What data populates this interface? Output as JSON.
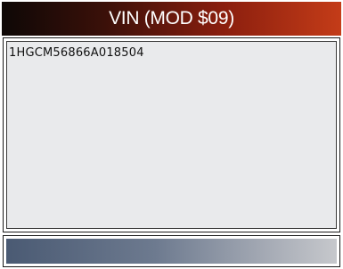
{
  "screen": {
    "title": "VIN (MOD $09)"
  },
  "content": {
    "vin": "1HGCM56866A018504"
  },
  "colors": {
    "title_gradient_start": "#0e0806",
    "title_gradient_end": "#c43c18",
    "panel_background": "#e9eaec",
    "status_gradient_start": "#4a5a73",
    "status_gradient_end": "#c6c8cc"
  }
}
